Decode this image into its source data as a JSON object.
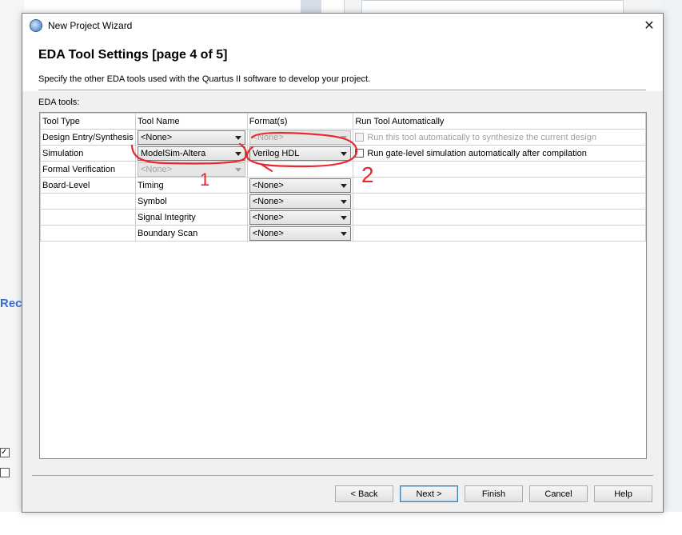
{
  "window": {
    "title": "New Project Wizard",
    "close_glyph": "✕"
  },
  "background": {
    "fragment_text": "Rec",
    "check_glyph": "✓"
  },
  "header": {
    "title": "EDA Tool Settings [page 4 of 5]",
    "subtitle": "Specify the other EDA tools used with the Quartus II software to develop your project."
  },
  "eda_label": "EDA tools:",
  "table": {
    "columns": [
      "Tool Type",
      "Tool Name",
      "Format(s)",
      "Run Tool Automatically"
    ],
    "rows": [
      {
        "tool_type": "Design Entry/Synthesis",
        "tool_name": "<None>",
        "format": "<None>",
        "format_enabled": false,
        "run_text": "Run this tool automatically to synthesize the current design",
        "run_enabled": false
      },
      {
        "tool_type": "Simulation",
        "tool_name": "ModelSim-Altera",
        "format": "Verilog HDL",
        "format_enabled": true,
        "run_text": "Run gate-level simulation automatically after compilation",
        "run_enabled": true
      },
      {
        "tool_type": "Formal Verification",
        "tool_name": "<None>",
        "tool_name_enabled": false
      },
      {
        "tool_type": "Board-Level",
        "tool_name": "Timing",
        "format": "<None>"
      },
      {
        "tool_type": "",
        "tool_name": "Symbol",
        "format": "<None>"
      },
      {
        "tool_type": "",
        "tool_name": "Signal Integrity",
        "format": "<None>"
      },
      {
        "tool_type": "",
        "tool_name": "Boundary Scan",
        "format": "<None>"
      }
    ]
  },
  "annotations": {
    "mark_1": "1",
    "mark_2": "2",
    "color": "#e8262c"
  },
  "buttons": {
    "back": "< Back",
    "next": "Next >",
    "finish": "Finish",
    "cancel": "Cancel",
    "help": "Help"
  }
}
